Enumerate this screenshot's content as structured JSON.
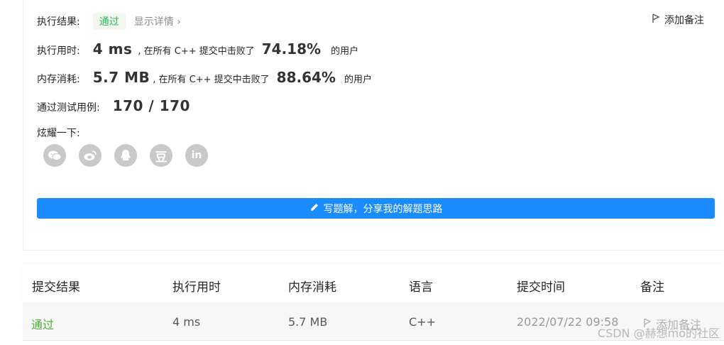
{
  "result": {
    "label": "执行结果:",
    "status": "通过",
    "detail_link": "显示详情 ›",
    "add_note": "添加备注"
  },
  "runtime": {
    "label": "执行用时:",
    "value": "4 ms",
    "text_before": ", 在所有 C++ 提交中击败了",
    "percent": "74.18%",
    "text_after": "的用户"
  },
  "memory": {
    "label": "内存消耗:",
    "value": "5.7 MB",
    "text_before": ", 在所有 C++ 提交中击败了",
    "percent": "88.64%",
    "text_after": "的用户"
  },
  "tests": {
    "label": "通过测试用例:",
    "value": "170 / 170"
  },
  "share": {
    "label": "炫耀一下:",
    "icons": [
      "wechat-icon",
      "weibo-icon",
      "qq-icon",
      "douban-icon",
      "linkedin-icon"
    ],
    "douban_char": "豆",
    "linkedin_text": "in"
  },
  "write_button": "写题解，分享我的解题思路",
  "table": {
    "headers": [
      "提交结果",
      "执行用时",
      "内存消耗",
      "语言",
      "提交时间",
      "备注"
    ],
    "row": {
      "status": "通过",
      "runtime": "4 ms",
      "memory": "5.7 MB",
      "language": "C++",
      "time": "2022/07/22 09:58",
      "note": "添加备注"
    }
  },
  "watermark": "CSDN @赫想mo的社区",
  "colors": {
    "accent": "#1a8cff",
    "success": "#2db55d",
    "success_light": "#f3f8ee"
  }
}
